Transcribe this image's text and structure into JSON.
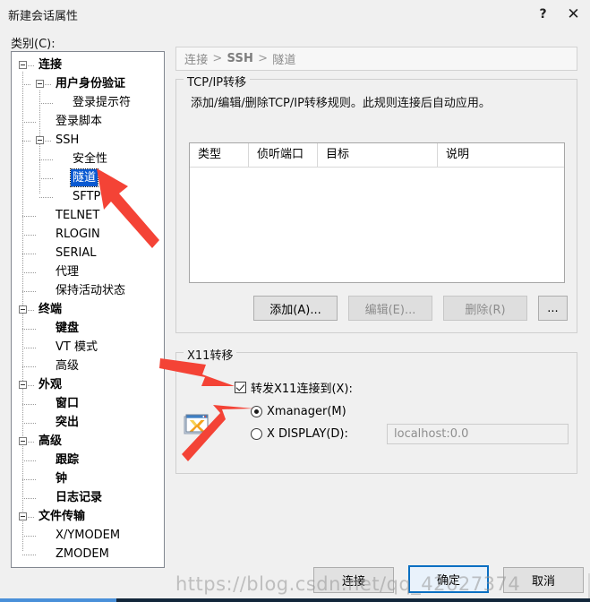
{
  "window": {
    "title": "新建会话属性",
    "help_icon": "?",
    "close_icon": "✕"
  },
  "category": {
    "label": "类别(C):",
    "tree": [
      {
        "label": "连接",
        "level": 0,
        "bold": true,
        "expander": true,
        "selected": false
      },
      {
        "label": "用户身份验证",
        "level": 1,
        "bold": true,
        "expander": true,
        "selected": false
      },
      {
        "label": "登录提示符",
        "level": 2,
        "bold": false,
        "expander": false,
        "selected": false
      },
      {
        "label": "登录脚本",
        "level": 1,
        "bold": false,
        "expander": false,
        "selected": false
      },
      {
        "label": "SSH",
        "level": 1,
        "bold": false,
        "expander": true,
        "selected": false
      },
      {
        "label": "安全性",
        "level": 2,
        "bold": false,
        "expander": false,
        "selected": false
      },
      {
        "label": "隧道",
        "level": 2,
        "bold": false,
        "expander": false,
        "selected": true
      },
      {
        "label": "SFTP",
        "level": 2,
        "bold": false,
        "expander": false,
        "selected": false
      },
      {
        "label": "TELNET",
        "level": 1,
        "bold": false,
        "expander": false,
        "selected": false
      },
      {
        "label": "RLOGIN",
        "level": 1,
        "bold": false,
        "expander": false,
        "selected": false
      },
      {
        "label": "SERIAL",
        "level": 1,
        "bold": false,
        "expander": false,
        "selected": false
      },
      {
        "label": "代理",
        "level": 1,
        "bold": false,
        "expander": false,
        "selected": false
      },
      {
        "label": "保持活动状态",
        "level": 1,
        "bold": false,
        "expander": false,
        "selected": false
      },
      {
        "label": "终端",
        "level": 0,
        "bold": true,
        "expander": true,
        "selected": false
      },
      {
        "label": "键盘",
        "level": 1,
        "bold": true,
        "expander": false,
        "selected": false
      },
      {
        "label": "VT 模式",
        "level": 1,
        "bold": false,
        "expander": false,
        "selected": false
      },
      {
        "label": "高级",
        "level": 1,
        "bold": false,
        "expander": false,
        "selected": false
      },
      {
        "label": "外观",
        "level": 0,
        "bold": true,
        "expander": true,
        "selected": false
      },
      {
        "label": "窗口",
        "level": 1,
        "bold": true,
        "expander": false,
        "selected": false
      },
      {
        "label": "突出",
        "level": 1,
        "bold": true,
        "expander": false,
        "selected": false
      },
      {
        "label": "高级",
        "level": 0,
        "bold": true,
        "expander": true,
        "selected": false
      },
      {
        "label": "跟踪",
        "level": 1,
        "bold": true,
        "expander": false,
        "selected": false
      },
      {
        "label": "钟",
        "level": 1,
        "bold": true,
        "expander": false,
        "selected": false
      },
      {
        "label": "日志记录",
        "level": 1,
        "bold": true,
        "expander": false,
        "selected": false
      },
      {
        "label": "文件传输",
        "level": 0,
        "bold": true,
        "expander": true,
        "selected": false
      },
      {
        "label": "X/YMODEM",
        "level": 1,
        "bold": false,
        "expander": false,
        "selected": false
      },
      {
        "label": "ZMODEM",
        "level": 1,
        "bold": false,
        "expander": false,
        "selected": false
      }
    ]
  },
  "breadcrumb": {
    "item1": "连接",
    "sep1": ">",
    "item2": "SSH",
    "sep2": ">",
    "item3": "隧道"
  },
  "tcp_group": {
    "legend": "TCP/IP转移",
    "description": "添加/编辑/删除TCP/IP转移规则。此规则连接后自动应用。",
    "columns": [
      {
        "label": "类型",
        "width": 66
      },
      {
        "label": "侦听端口",
        "width": 77
      },
      {
        "label": "目标",
        "width": 134
      },
      {
        "label": "说明",
        "width": 141
      }
    ],
    "rows": [],
    "buttons": {
      "add": {
        "label": "添加(A)...",
        "enabled": true
      },
      "edit": {
        "label": "编辑(E)...",
        "enabled": false
      },
      "delete": {
        "label": "删除(R)",
        "enabled": false
      },
      "more": {
        "label": "...",
        "enabled": true
      }
    }
  },
  "x11_group": {
    "legend": "X11转移",
    "icon": "xmanager-icon",
    "forward_checkbox": {
      "label": "转发X11连接到(X):",
      "checked": true
    },
    "radio_xmanager": {
      "label": "Xmanager(M)",
      "selected": true
    },
    "radio_xdisplay": {
      "label": "X DISPLAY(D):",
      "selected": false
    },
    "xdisplay_value": "localhost:0.0"
  },
  "footer": {
    "connect": "连接",
    "ok": "确定",
    "cancel": "取消"
  },
  "watermark": "https://blog.csdn.net/qq_42627374",
  "colors": {
    "selection": "#0a59d1",
    "default_button_border": "#0a6fc2",
    "annotation_arrow": "#f44336",
    "dialog_bg": "#f0f0f0"
  }
}
